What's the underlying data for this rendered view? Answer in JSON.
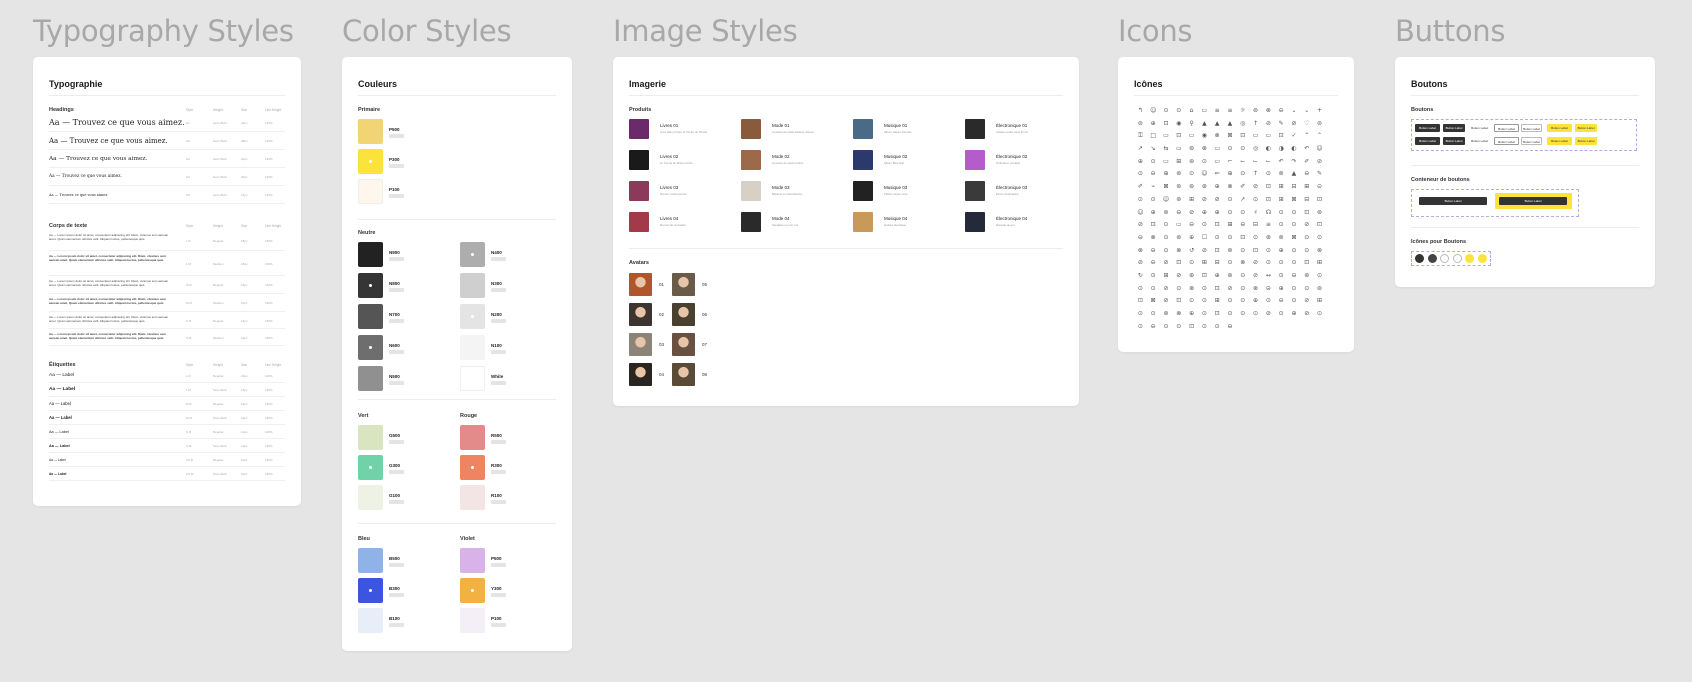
{
  "sections": {
    "typography": "Typography Styles",
    "color": "Color Styles",
    "image": "Image Styles",
    "icons": "Icons",
    "buttons": "Buttons"
  },
  "typo": {
    "title": "Typographie",
    "col_headers": [
      "Style",
      "Weight",
      "Size",
      "Line Height"
    ],
    "headings": {
      "label": "Headings",
      "rows": [
        {
          "text": "Aa — Trouvez ce que vous aimez.",
          "c": [
            "H1",
            "Semi Bold",
            "32px",
            "120%"
          ]
        },
        {
          "text": "Aa — Trouvez ce que vous aimez.",
          "c": [
            "H2",
            "Semi Bold",
            "28px",
            "120%"
          ]
        },
        {
          "text": "Aa — Trouvez ce que vous aimez.",
          "c": [
            "H3",
            "Semi Bold",
            "24px",
            "120%"
          ]
        },
        {
          "text": "Aa — Trouvez ce que vous aimez.",
          "c": [
            "H4",
            "Semi Bold",
            "20px",
            "120%"
          ]
        },
        {
          "text": "Aa — Trouvez ce que vous aimez.",
          "c": [
            "H5",
            "Semi Bold",
            "16px",
            "120%"
          ]
        }
      ]
    },
    "body": {
      "label": "Corps de texte",
      "rows": [
        {
          "text": "Aa — Lorem ipsum dolor sit amet, consectetur adipiscing elit. Diam, vivamus sem aenean amet. Quam elementum ultricies velit. Aliquam luctus, pellentesque quis.",
          "c": [
            "L R",
            "Regular",
            "18px",
            "150%"
          ]
        },
        {
          "text": "Aa — Lorem ipsum dolor sit amet, consectetur adipiscing elit. Diam, vivamus sem aenean amet. Quam elementum ultricies velit. Aliquam luctus, pellentesque quis.",
          "c": [
            "L M",
            "Medium",
            "18px",
            "150%"
          ]
        },
        {
          "text": "Aa — Lorem ipsum dolor sit amet, consectetur adipiscing elit. Diam, vivamus sem aenean amet. Quam elementum ultricies velit. Aliquam luctus, pellentesque quis.",
          "c": [
            "M R",
            "Regular",
            "16px",
            "150%"
          ]
        },
        {
          "text": "Aa — Lorem ipsum dolor sit amet, consectetur adipiscing elit. Diam, vivamus sem aenean amet. Quam elementum ultricies velit. Aliquam luctus, pellentesque quis.",
          "c": [
            "M M",
            "Medium",
            "16px",
            "150%"
          ]
        },
        {
          "text": "Aa — Lorem ipsum dolor sit amet, consectetur adipiscing elit. Diam, vivamus sem aenean amet. Quam elementum ultricies velit. Aliquam luctus, pellentesque quis.",
          "c": [
            "S R",
            "Regular",
            "14px",
            "150%"
          ]
        },
        {
          "text": "Aa — Lorem ipsum dolor sit amet, consectetur adipiscing elit. Diam, vivamus sem aenean amet. Quam elementum ultricies velit. Aliquam luctus, pellentesque quis.",
          "c": [
            "S M",
            "Medium",
            "14px",
            "150%"
          ]
        }
      ]
    },
    "labels": {
      "label": "Étiquettes",
      "rows": [
        {
          "text": "Aa — Label",
          "c": [
            "L R",
            "Regular",
            "16px",
            "120%"
          ]
        },
        {
          "text": "Aa — Label",
          "c": [
            "L M",
            "Semi Bold",
            "16px",
            "120%"
          ]
        },
        {
          "text": "Aa — Label",
          "c": [
            "M R",
            "Regular",
            "14px",
            "120%"
          ]
        },
        {
          "text": "Aa — Label",
          "c": [
            "M M",
            "Semi Bold",
            "14px",
            "120%"
          ]
        },
        {
          "text": "Aa — Label",
          "c": [
            "S R",
            "Regular",
            "12px",
            "120%"
          ]
        },
        {
          "text": "Aa — Label",
          "c": [
            "S M",
            "Semi Bold",
            "12px",
            "120%"
          ]
        },
        {
          "text": "Aa — Label",
          "c": [
            "XS R",
            "Regular",
            "10px",
            "120%"
          ]
        },
        {
          "text": "Aa — Label",
          "c": [
            "XS M",
            "Semi Bold",
            "10px",
            "120%"
          ]
        }
      ]
    }
  },
  "colors": {
    "title": "Couleurs",
    "primary": {
      "label": "Primaire",
      "items": [
        {
          "name": "P500",
          "hex": "#f2d474"
        },
        {
          "name": "P300",
          "hex": "#fce23c",
          "dot": true
        },
        {
          "name": "P100",
          "hex": "#fff7ed"
        }
      ]
    },
    "neutral": {
      "label": "Neutre",
      "left": [
        {
          "name": "N900",
          "hex": "#222222"
        },
        {
          "name": "N800",
          "hex": "#353535",
          "dot": true
        },
        {
          "name": "N700",
          "hex": "#555555"
        },
        {
          "name": "N600",
          "hex": "#6e6e6e",
          "dot": true
        },
        {
          "name": "N500",
          "hex": "#909090"
        }
      ],
      "right": [
        {
          "name": "N400",
          "hex": "#adadad",
          "dot": true
        },
        {
          "name": "N300",
          "hex": "#cfcfcf"
        },
        {
          "name": "N200",
          "hex": "#e4e4e4",
          "dot": true
        },
        {
          "name": "N100",
          "hex": "#f4f4f4"
        },
        {
          "name": "White",
          "hex": "#ffffff"
        }
      ]
    },
    "green": {
      "label": "Vert",
      "items": [
        {
          "name": "G500",
          "hex": "#d9e4c1"
        },
        {
          "name": "G300",
          "hex": "#6fd3a7",
          "dot": true
        },
        {
          "name": "G100",
          "hex": "#eef2e4"
        }
      ]
    },
    "red": {
      "label": "Rouge",
      "items": [
        {
          "name": "R500",
          "hex": "#e38b8b"
        },
        {
          "name": "R300",
          "hex": "#ef8462",
          "dot": true
        },
        {
          "name": "R100",
          "hex": "#f4e5e5"
        }
      ]
    },
    "blue": {
      "label": "Bleu",
      "items": [
        {
          "name": "B500",
          "hex": "#8fb3e6"
        },
        {
          "name": "B300",
          "hex": "#3c55e0",
          "dot": true
        },
        {
          "name": "B100",
          "hex": "#e7eef7"
        }
      ]
    },
    "violet": {
      "label": "Violet",
      "items": [
        {
          "name": "P500",
          "hex": "#d8b3ea"
        },
        {
          "name": "Y300",
          "hex": "#f1b241",
          "dot": true
        },
        {
          "name": "P100",
          "hex": "#f4eef7"
        }
      ]
    }
  },
  "images": {
    "title": "Imagerie",
    "products_label": "Produits",
    "products": [
      {
        "name": "Livres 01",
        "desc": "Livre Harry Potter et l'Ordre du Phénix",
        "color": "#6b2a6a"
      },
      {
        "name": "Mode 01",
        "desc": "Lunettes de soleil aviateur dorées",
        "color": "#8a5a3c"
      },
      {
        "name": "Musique 01",
        "desc": "Album Nature Sounds",
        "color": "#4a6b88"
      },
      {
        "name": "Électronique 01",
        "desc": "Casque audio sans fil noir",
        "color": "#2a2a2a"
      },
      {
        "name": "Livres 02",
        "desc": "Le Comte de Monte-Cristo",
        "color": "#1a1a1a"
      },
      {
        "name": "Mode 02",
        "desc": "Lunettes de soleil rondes",
        "color": "#9c6a4a"
      },
      {
        "name": "Musique 02",
        "desc": "Album Bleu Nuit",
        "color": "#2b3a6b"
      },
      {
        "name": "Électronique 02",
        "desc": "Ordinateur portable",
        "color": "#b45cc9"
      },
      {
        "name": "Livres 03",
        "desc": "Roman contemporain",
        "color": "#8c3a5c"
      },
      {
        "name": "Mode 03",
        "desc": "Baskets en toile blanche",
        "color": "#d7d0c4"
      },
      {
        "name": "Musique 03",
        "desc": "Platine vinyle noire",
        "color": "#222222"
      },
      {
        "name": "Électronique 03",
        "desc": "Écran d'ordinateur",
        "color": "#3a3a3a"
      },
      {
        "name": "Livres 04",
        "desc": "Recueil de nouvelles",
        "color": "#a33a4a"
      },
      {
        "name": "Mode 04",
        "desc": "Sandales en cuir noir",
        "color": "#2a2a2a"
      },
      {
        "name": "Musique 04",
        "desc": "Guitare électrique",
        "color": "#c89a5a"
      },
      {
        "name": "Électronique 04",
        "desc": "Manette de jeu",
        "color": "#242a3a"
      }
    ],
    "avatars_label": "Avatars",
    "avatars": [
      {
        "n": "01",
        "c": "#b0552c"
      },
      {
        "n": "05",
        "c": "#6a5a48"
      },
      {
        "n": "02",
        "c": "#3e3530"
      },
      {
        "n": "06",
        "c": "#4a4030"
      },
      {
        "n": "03",
        "c": "#8c8478"
      },
      {
        "n": "07",
        "c": "#6a5040"
      },
      {
        "n": "04",
        "c": "#2a2520"
      },
      {
        "n": "08",
        "c": "#5a4a38"
      }
    ]
  },
  "icons": {
    "title": "Icônes",
    "glyphs": "↰☺⊙⊙⌂▭≡≡☼⊚⊗⊖⌄⌄+⊜⊕⊡◉⚲▲▲▲◎↑⊘✎⊘♡⊜⚿□▭⊡▭◉⊗⊠⊡▭▭⊡✓⌃⌃↗↘⇆▭⊚⊗▭⊙⊙◎◐◑◐↶☺⊕⊙▭⊞⊚⊙▭⌐⌙⌙⌙↶↷✐⊘⊙⊖⊕⊚⊙☺⇐⊕⊙↑⊙⊚▲⊖✎✐⌁⊠⊚⊚⊛⊕⊗✐⊘⊡⊞⊟⊞⊝⊙⊙☺⊚⊞⊘⊘⊙↗⊙⊡⊞⊠⊟⊡☺⊕⊚⊖⊘⊕⊕⊙⊙♯☊⊙⊙⊡⊚⊘⊡⊙▭⊖⊙⊡⊞⊖⊟≡⊙⊙⊘⊡⊖⊗⊙⊚⊕☐⊙⊙⊡⊙⊛⊚⊠⊙⊙⊗⊖⊙⊗↺⊘⊡⊚⊙⊡⊙⊕⊙⊙⊗⊘⊖⊘⊡⊙⊞⊟⊙⊗⊘⊙⊙⊙⊡⊞↻⊙⊞⊘⊛⊡⊕⊚⊙⊘↔⊙⊖⊚⊙⊙⊙⊘⊙⊗⊙⊡⊘⊙⊗⊖⊕⊙⊙⊚⊡⊠⊘⊡⊙⊙⊞⊙⊙⊕⊙⊖⊙⊘⊞⊙⊙⊚⊗⊕⊙⊡⊙⊙⊙⊘⊙⊕⊘⊙⊙⊖⊙⊙⊡⊙⊙⊖⊙⊖⊙⊙⊘⊙⊕⊙⊙⊘⊙⊗⊙⊙⊖⊙⊙⊡⊚⊙⊙⊙⊙⊙⊘⊙⊙⊕⊙⊖⊙⊙⊗⊙⊙⊘⊙⊙⊕⊖⊙⊙⊙⊘⊙⊙⊚⊙⊙⊡⊙⊙⊘⊖⊙⊙⊙⊙⊘⊙⊕⊙⊙⊚⊙⊙⊖⊙⊘⊙⊙⊙⊙⊡⊙⊙⊗⊙⊙⊙⊖⊙⊙⊘⊙⊚⊙⊙⊖⊙"
  },
  "buttons": {
    "title": "Boutons",
    "sec1": "Boutons",
    "sec2": "Conteneur de boutons",
    "sec3": "Icônes pour Boutons",
    "label": "Button Label"
  }
}
